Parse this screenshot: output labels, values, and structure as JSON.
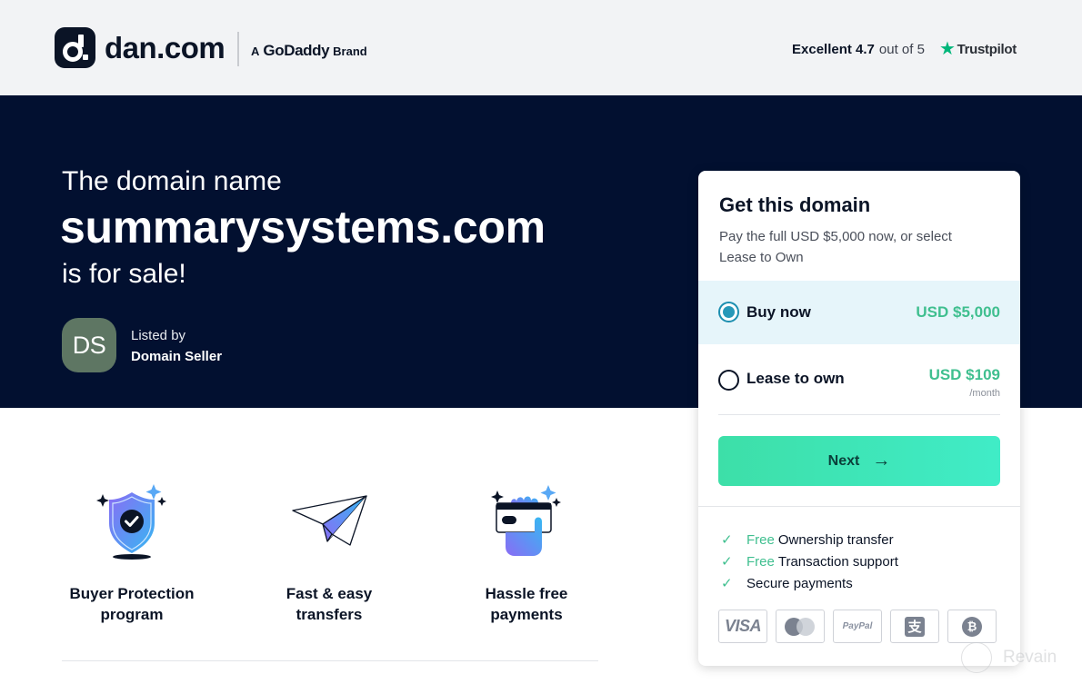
{
  "header": {
    "logo_text": "dan.com",
    "brand_prefix": "A",
    "brand_name": "GoDaddy",
    "brand_suffix": "Brand",
    "rating_label": "Excellent 4.7",
    "rating_suffix": "out of 5",
    "trustpilot_label": "Trustpilot"
  },
  "hero": {
    "pre_title": "The domain name",
    "domain": "summarysystems.com",
    "post_title": "is for sale!",
    "seller_initials": "DS",
    "listed_by_label": "Listed by",
    "seller_name": "Domain Seller"
  },
  "features": [
    {
      "icon": "shield-check-icon",
      "label_line1": "Buyer Protection",
      "label_line2": "program"
    },
    {
      "icon": "paper-plane-icon",
      "label_line1": "Fast & easy",
      "label_line2": "transfers"
    },
    {
      "icon": "hand-card-icon",
      "label_line1": "Hassle free",
      "label_line2": "payments"
    }
  ],
  "card": {
    "title": "Get this domain",
    "subtitle": "Pay the full USD $5,000 now, or select Lease to Own",
    "options": [
      {
        "name": "Buy now",
        "price": "USD $5,000",
        "selected": true
      },
      {
        "name": "Lease to own",
        "price": "USD $109",
        "period": "/month",
        "selected": false
      }
    ],
    "next_label": "Next",
    "benefits": [
      {
        "free": "Free",
        "text": "Ownership transfer"
      },
      {
        "free": "Free",
        "text": "Transaction support"
      },
      {
        "free": "",
        "text": "Secure payments"
      }
    ],
    "payment_methods": [
      "VISA",
      "Mastercard",
      "PayPal",
      "Alipay",
      "Bitcoin"
    ],
    "paypal_label": "PayPal",
    "visa_label": "VISA",
    "alipay_glyph": "支",
    "bitcoin_glyph": "₿"
  },
  "watermark": {
    "text": "Revain"
  },
  "colors": {
    "hero_bg": "#021030",
    "accent_green": "#3fbf8f",
    "button_gradient_start": "#3ddfa8",
    "selected_bg": "#e6f5fa",
    "avatar_bg": "#5e7663"
  }
}
